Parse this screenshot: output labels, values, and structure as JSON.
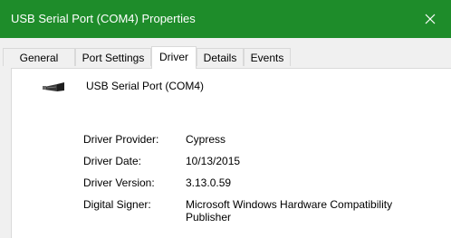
{
  "window": {
    "title": "USB Serial Port (COM4) Properties",
    "close_icon": "close-icon",
    "accent_color": "#1e8c2a"
  },
  "tabs": [
    {
      "label": "General"
    },
    {
      "label": "Port Settings"
    },
    {
      "label": "Driver",
      "active": true
    },
    {
      "label": "Details"
    },
    {
      "label": "Events"
    }
  ],
  "device": {
    "icon": "usb-connector-icon",
    "name": "USB Serial Port (COM4)"
  },
  "driver_info": [
    {
      "label": "Driver Provider:",
      "value": "Cypress"
    },
    {
      "label": "Driver Date:",
      "value": "10/13/2015"
    },
    {
      "label": "Driver Version:",
      "value": "3.13.0.59"
    },
    {
      "label": "Digital Signer:",
      "value": "Microsoft Windows Hardware Compatibility Publisher"
    }
  ]
}
